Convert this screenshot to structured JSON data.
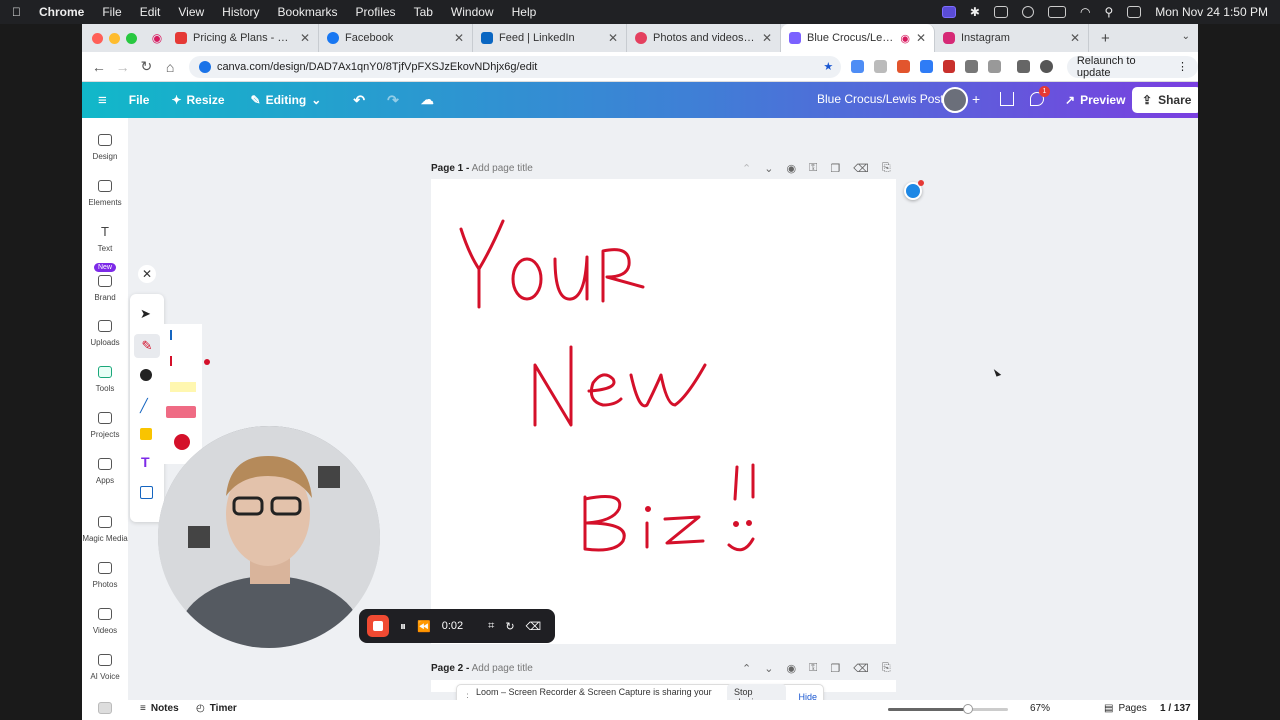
{
  "menubar": {
    "app_name": "Chrome",
    "items": [
      "File",
      "Edit",
      "View",
      "History",
      "Bookmarks",
      "Profiles",
      "Tab",
      "Window",
      "Help"
    ],
    "datetime": "Mon Nov 24  1:50 PM"
  },
  "tabs": [
    {
      "title": "Pricing & Plans - Local Citatio",
      "color": "#e53935"
    },
    {
      "title": "Facebook",
      "color": "#1877f2"
    },
    {
      "title": "Feed | LinkedIn",
      "color": "#0a66c2"
    },
    {
      "title": "Photos and videos for Ramz…",
      "color": "#e4405f"
    },
    {
      "title": "Blue Crocus/Lewis Posts",
      "color": "#7b61ff",
      "active": true
    },
    {
      "title": "Instagram",
      "color": "#d62976"
    }
  ],
  "address": {
    "url": "canva.com/design/DAD7Ax1qnY0/8TjfVpFXSJzEkovNDhjx6g/edit",
    "relaunch_label": "Relaunch to update"
  },
  "canva_header": {
    "file_label": "File",
    "resize_label": "Resize",
    "editing_label": "Editing",
    "doc_title": "Blue Crocus/Lewis Posts",
    "preview_label": "Preview",
    "share_label": "Share",
    "comment_badge": "1"
  },
  "sidebar": {
    "items": [
      {
        "label": "Design",
        "icon": "layout-icon"
      },
      {
        "label": "Elements",
        "icon": "shapes-icon"
      },
      {
        "label": "Text",
        "icon": "text-icon"
      },
      {
        "label": "Brand",
        "icon": "brand-icon",
        "badge": "New"
      },
      {
        "label": "Uploads",
        "icon": "upload-icon"
      },
      {
        "label": "Tools",
        "icon": "draw-icon"
      },
      {
        "label": "Projects",
        "icon": "folder-icon"
      },
      {
        "label": "Apps",
        "icon": "apps-icon"
      },
      {
        "label": "Magic Media",
        "icon": "magic-icon"
      },
      {
        "label": "Photos",
        "icon": "photo-icon"
      },
      {
        "label": "Videos",
        "icon": "video-icon"
      },
      {
        "label": "AI Voice",
        "icon": "voice-icon"
      }
    ]
  },
  "pages": [
    {
      "label": "Page 1 -",
      "title_placeholder": "Add page title"
    },
    {
      "label": "Page 2 -",
      "title_placeholder": "Add page title"
    }
  ],
  "canvas_text": [
    "YOUR",
    "New",
    "Biz",
    "!!",
    ":)"
  ],
  "loom": {
    "timer": "0:02",
    "sharing_message": "Loom – Screen Recorder & Screen Capture is sharing your screen.",
    "stop_label": "Stop sharing",
    "hide_label": "Hide"
  },
  "bottom": {
    "notes_label": "Notes",
    "timer_label": "Timer",
    "zoom": "67%",
    "zoom_fraction": 0.67,
    "pages_label": "Pages",
    "page_count": "1 / 137"
  },
  "colors": {
    "ink": "#d4102a",
    "brand_start": "#11b8c9",
    "brand_end": "#7a3fe0"
  }
}
